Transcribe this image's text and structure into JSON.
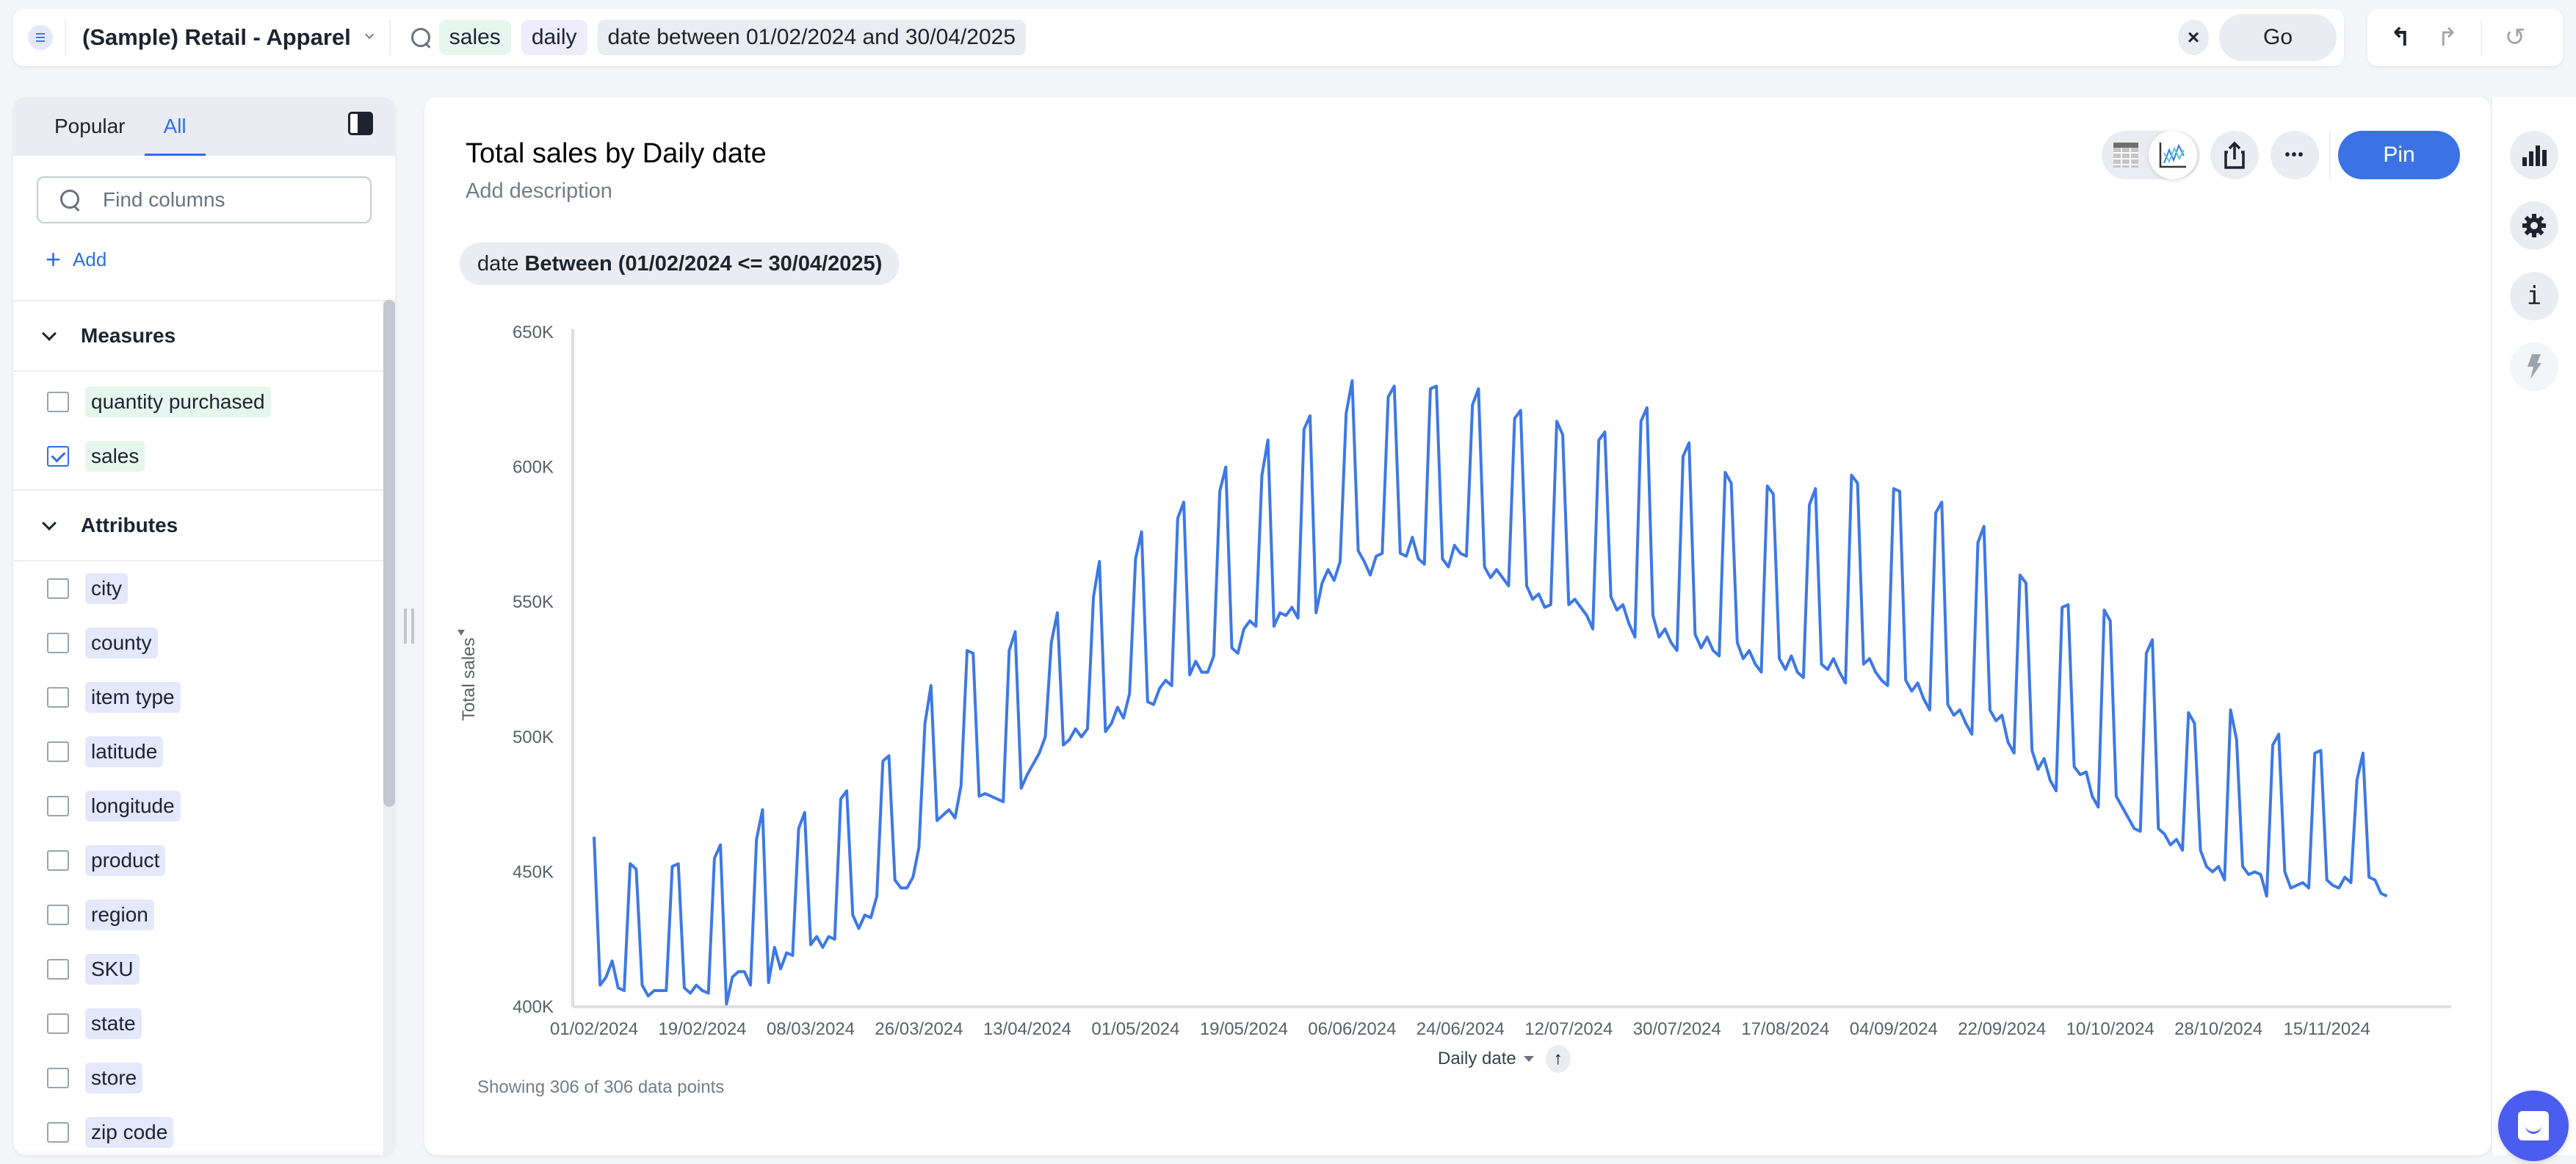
{
  "topbar": {
    "datasource": "(Sample) Retail - Apparel",
    "tokens": [
      {
        "text": "sales",
        "kind": "measure"
      },
      {
        "text": "daily",
        "kind": "attribute"
      },
      {
        "text": "date between 01/02/2024 and 30/04/2025",
        "kind": "filter"
      }
    ],
    "clear_icon": "×",
    "go_label": "Go"
  },
  "history": {
    "undo_icon": "↰",
    "redo_icon": "↱",
    "reset_icon": "↺"
  },
  "left_panel": {
    "tabs": [
      {
        "label": "Popular",
        "active": false
      },
      {
        "label": "All",
        "active": true
      }
    ],
    "find_placeholder": "Find columns",
    "add_label": "Add",
    "measures_label": "Measures",
    "measures": [
      {
        "label": "quantity purchased",
        "checked": false
      },
      {
        "label": "sales",
        "checked": true
      }
    ],
    "attributes_label": "Attributes",
    "attributes": [
      {
        "label": "city",
        "checked": false
      },
      {
        "label": "county",
        "checked": false
      },
      {
        "label": "item type",
        "checked": false
      },
      {
        "label": "latitude",
        "checked": false
      },
      {
        "label": "longitude",
        "checked": false
      },
      {
        "label": "product",
        "checked": false
      },
      {
        "label": "region",
        "checked": false
      },
      {
        "label": "SKU",
        "checked": false
      },
      {
        "label": "state",
        "checked": false
      },
      {
        "label": "store",
        "checked": false
      },
      {
        "label": "zip code",
        "checked": false
      }
    ]
  },
  "card": {
    "title": "Total sales by Daily date",
    "description_placeholder": "Add description",
    "filter_prefix": "date",
    "filter_value": "Between (01/02/2024 <= 30/04/2025)",
    "pin_label": "Pin",
    "more_icon": "•••",
    "footer": "Showing 306 of 306 data points",
    "sort_icon": "↑"
  },
  "rail": {
    "info_icon": "i"
  },
  "colors": {
    "accent": "#3b73e6",
    "line": "#3d78e6",
    "chat": "#4b5cf0"
  },
  "chart_data": {
    "type": "line",
    "title": "Total sales by Daily date",
    "xlabel": "Daily date",
    "ylabel": "Total sales",
    "ylim": [
      400000,
      650000
    ],
    "yticks": [
      400000,
      450000,
      500000,
      550000,
      600000,
      650000
    ],
    "ytick_labels": [
      "400K",
      "450K",
      "500K",
      "550K",
      "600K",
      "650K"
    ],
    "x_start": "01/02/2024",
    "x_step_days": 1,
    "x_count": 306,
    "xtick_labels": [
      "01/02/2024",
      "19/02/2024",
      "08/03/2024",
      "26/03/2024",
      "13/04/2024",
      "01/05/2024",
      "19/05/2024",
      "06/06/2024",
      "24/06/2024",
      "12/07/2024",
      "30/07/2024",
      "17/08/2024",
      "04/09/2024",
      "22/09/2024",
      "10/10/2024",
      "28/10/2024",
      "15/11/2024"
    ],
    "xtick_interval_days": 18,
    "grid": false,
    "legend": "none",
    "series": [
      {
        "name": "Total sales",
        "values": [
          463000,
          408000,
          411000,
          417000,
          407000,
          406000,
          453000,
          451000,
          408000,
          404000,
          406000,
          406000,
          406000,
          452000,
          453000,
          407000,
          405000,
          408000,
          406000,
          405000,
          455000,
          460000,
          401000,
          411000,
          413000,
          413000,
          408000,
          462000,
          473000,
          409000,
          422000,
          414000,
          420000,
          419000,
          466000,
          472000,
          423000,
          426000,
          422000,
          426000,
          425000,
          477000,
          480000,
          434000,
          429000,
          434000,
          433000,
          441000,
          491000,
          493000,
          447000,
          444000,
          444000,
          448000,
          459000,
          505000,
          519000,
          469000,
          471000,
          473000,
          470000,
          482000,
          532000,
          531000,
          478000,
          479000,
          478000,
          477000,
          476000,
          532000,
          539000,
          481000,
          486000,
          490000,
          494000,
          500000,
          535000,
          546000,
          497000,
          499000,
          503000,
          500000,
          503000,
          552000,
          565000,
          502000,
          505000,
          511000,
          507000,
          516000,
          566000,
          576000,
          513000,
          512000,
          518000,
          521000,
          519000,
          581000,
          587000,
          523000,
          528000,
          524000,
          524000,
          530000,
          591000,
          600000,
          533000,
          531000,
          540000,
          543000,
          541000,
          597000,
          610000,
          541000,
          546000,
          545000,
          548000,
          544000,
          614000,
          619000,
          546000,
          557000,
          562000,
          558000,
          565000,
          620000,
          632000,
          569000,
          565000,
          560000,
          567000,
          568000,
          626000,
          630000,
          568000,
          567000,
          574000,
          566000,
          564000,
          629000,
          630000,
          566000,
          563000,
          571000,
          568000,
          567000,
          623000,
          629000,
          563000,
          559000,
          562000,
          559000,
          556000,
          618000,
          621000,
          556000,
          551000,
          553000,
          548000,
          549000,
          617000,
          612000,
          549000,
          551000,
          548000,
          545000,
          540000,
          610000,
          613000,
          552000,
          547000,
          549000,
          542000,
          537000,
          617000,
          622000,
          545000,
          537000,
          540000,
          535000,
          532000,
          604000,
          609000,
          538000,
          533000,
          537000,
          532000,
          530000,
          598000,
          594000,
          535000,
          529000,
          532000,
          527000,
          524000,
          593000,
          590000,
          529000,
          525000,
          530000,
          524000,
          522000,
          586000,
          592000,
          527000,
          525000,
          529000,
          524000,
          520000,
          597000,
          594000,
          527000,
          529000,
          524000,
          521000,
          519000,
          592000,
          591000,
          521000,
          517000,
          520000,
          514000,
          510000,
          583000,
          587000,
          512000,
          508000,
          510000,
          505000,
          501000,
          572000,
          578000,
          510000,
          506000,
          508000,
          498000,
          494000,
          560000,
          557000,
          495000,
          488000,
          492000,
          484000,
          480000,
          548000,
          549000,
          489000,
          486000,
          487000,
          478000,
          474000,
          547000,
          543000,
          478000,
          474000,
          470000,
          466000,
          465000,
          531000,
          536000,
          466000,
          464000,
          460000,
          462000,
          458000,
          509000,
          505000,
          458000,
          452000,
          450000,
          452000,
          447000,
          510000,
          499000,
          452000,
          449000,
          450000,
          449000,
          441000,
          497000,
          501000,
          450000,
          444000,
          445000,
          446000,
          444000,
          494000,
          495000,
          447000,
          445000,
          444000,
          448000,
          446000,
          484000,
          494000,
          448000,
          447000,
          442000,
          441000
        ]
      }
    ]
  }
}
